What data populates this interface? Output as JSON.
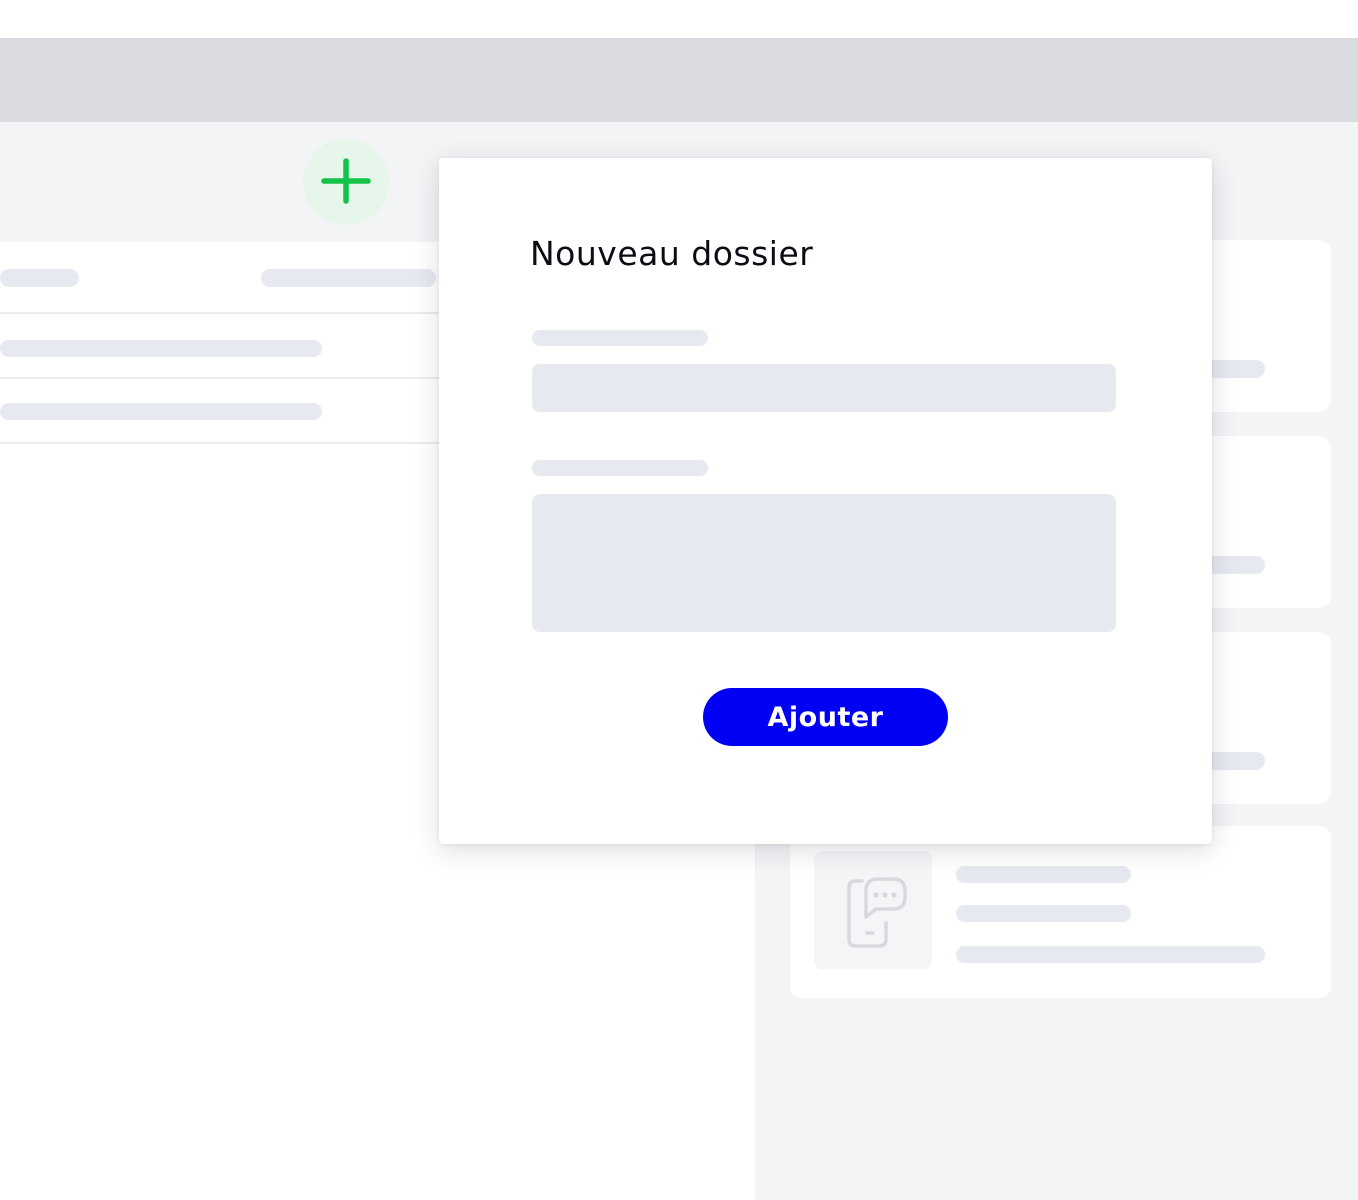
{
  "modal": {
    "title": "Nouveau dossier",
    "submit_label": "Ajouter"
  },
  "colors": {
    "accent_blue": "#0000f5",
    "add_icon_green": "#14c24a",
    "add_icon_bg": "#e6f6ea",
    "topbar": "#dadbe0",
    "panel_bg": "#f3f4f6",
    "skeleton": "#e7e9f1"
  },
  "icons": {
    "add_button": "plus-icon",
    "card_thumbnail": "phone-chat-icon"
  }
}
